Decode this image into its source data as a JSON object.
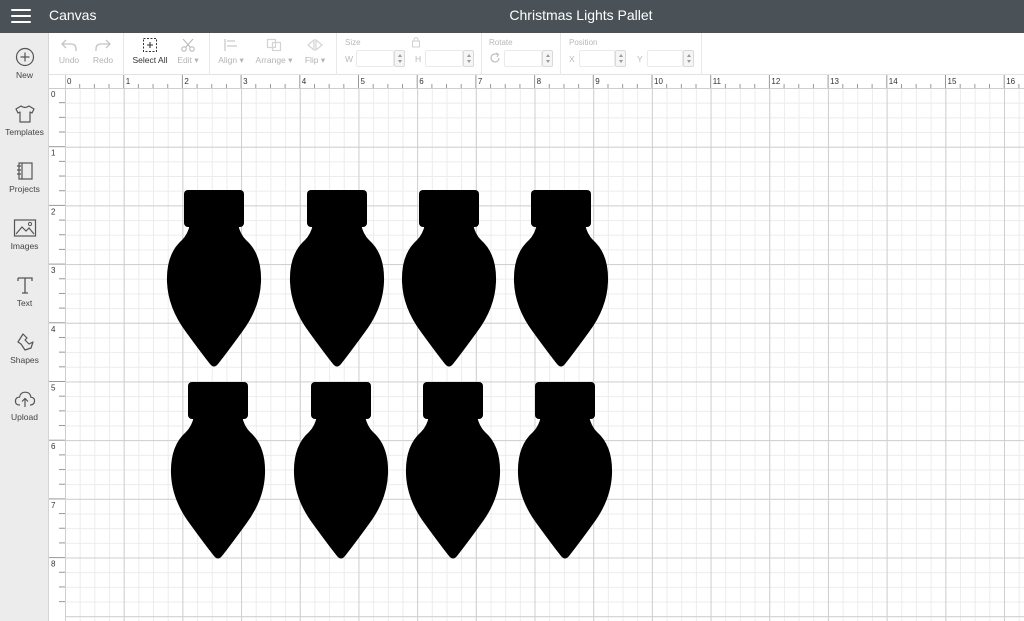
{
  "header": {
    "app_title": "Canvas",
    "project_title": "Christmas Lights Pallet"
  },
  "sidebar": {
    "items": [
      {
        "label": "New",
        "icon": "plus-circle-icon"
      },
      {
        "label": "Templates",
        "icon": "tshirt-icon"
      },
      {
        "label": "Projects",
        "icon": "notebook-icon"
      },
      {
        "label": "Images",
        "icon": "image-icon"
      },
      {
        "label": "Text",
        "icon": "text-icon"
      },
      {
        "label": "Shapes",
        "icon": "shapes-icon"
      },
      {
        "label": "Upload",
        "icon": "cloud-upload-icon"
      }
    ]
  },
  "toolbar": {
    "undo_label": "Undo",
    "redo_label": "Redo",
    "select_all_label": "Select All",
    "edit_label": "Edit",
    "align_label": "Align",
    "arrange_label": "Arrange",
    "flip_label": "Flip",
    "size_label": "Size",
    "w_label": "W",
    "h_label": "H",
    "rotate_label": "Rotate",
    "position_label": "Position",
    "x_label": "X",
    "y_label": "Y"
  },
  "rulers": {
    "top": [
      "0",
      "1",
      "2",
      "3",
      "4",
      "5",
      "6",
      "7",
      "8",
      "9",
      "10",
      "11",
      "12",
      "13",
      "14",
      "15",
      "16"
    ],
    "left": [
      "0",
      "1",
      "2",
      "3",
      "4",
      "5",
      "6",
      "7",
      "8"
    ]
  },
  "canvas": {
    "shape_name": "christmas-light-bulb",
    "shape_color": "#000000",
    "rows": 2,
    "columns": 4
  },
  "colors": {
    "header_bg": "#4a5257",
    "sidebar_bg": "#ececec",
    "grid_major": "#cfcfcf",
    "grid_minor": "#ececec"
  }
}
